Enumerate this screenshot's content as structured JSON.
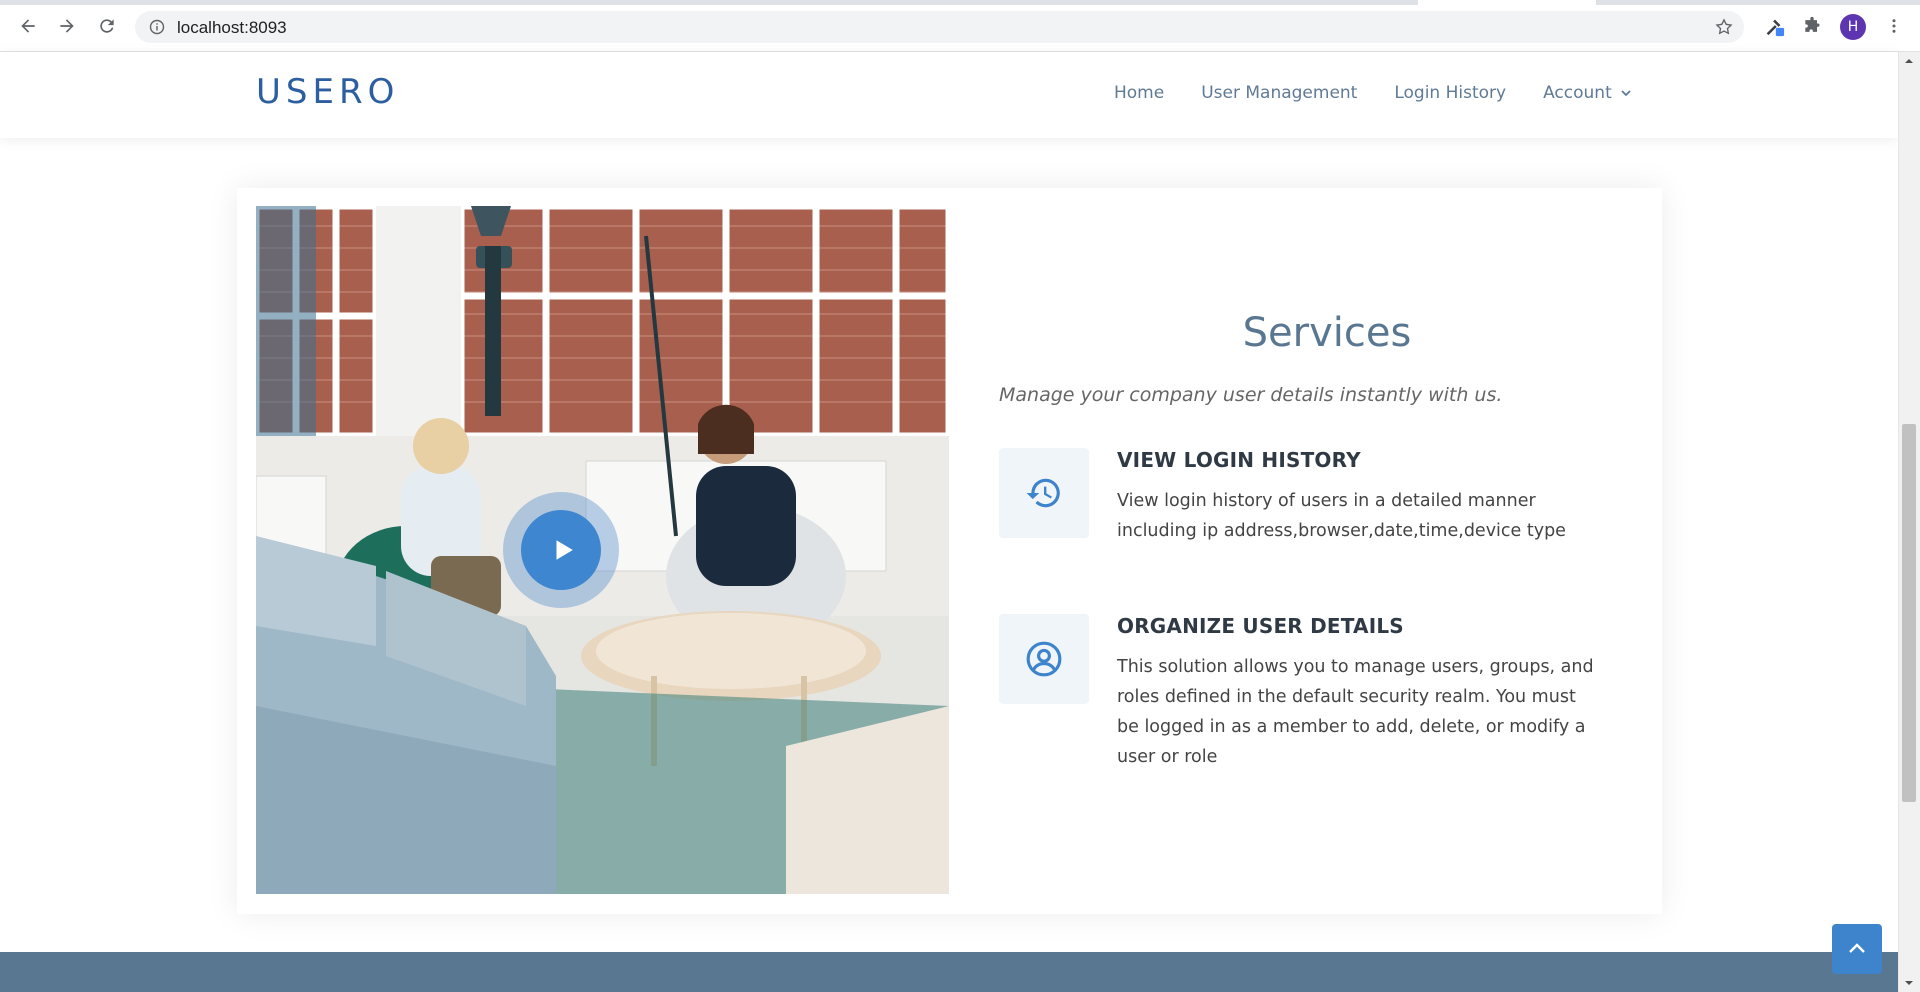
{
  "browser": {
    "url": "localhost:8093",
    "profile_initial": "H",
    "icons": [
      "back-icon",
      "forward-icon",
      "reload-icon",
      "info-icon",
      "star-icon",
      "extension-icon",
      "puzzle-icon",
      "menu-icon"
    ]
  },
  "site": {
    "logo": "USERO",
    "nav": [
      {
        "label": "Home"
      },
      {
        "label": "User Management"
      },
      {
        "label": "Login History"
      },
      {
        "label": "Account"
      }
    ]
  },
  "services": {
    "title": "Services",
    "subtitle": "Manage your company user details instantly with us.",
    "features": [
      {
        "icon": "history-icon",
        "title": "VIEW LOGIN HISTORY",
        "description": "View login history of users in a detailed manner including ip address,browser,date,time,device type"
      },
      {
        "icon": "user-circle-icon",
        "title": "ORGANIZE USER DETAILS",
        "description": "This solution allows you to manage users, groups, and roles defined in the default security realm. You must be logged in as a member to add, delete, or modify a user or role"
      }
    ]
  },
  "colors": {
    "brand": "#2d5fa0",
    "accent": "#3f86d0",
    "nav_text": "#5f7a95",
    "footer": "#5a7792"
  }
}
